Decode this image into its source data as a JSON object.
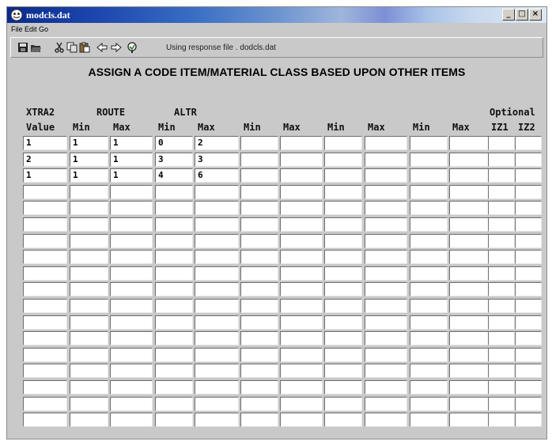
{
  "window": {
    "title": "modcls.dat"
  },
  "menu": [
    "File",
    "Edit",
    "Go"
  ],
  "toolbar": {
    "icons": [
      "save-icon",
      "open-icon",
      "cut-icon",
      "copy-icon",
      "paste-icon",
      "back-arrow-icon",
      "forward-arrow-icon",
      "run-icon"
    ],
    "status": "Using response file . dodcls.dat"
  },
  "heading": "ASSIGN A CODE ITEM/MATERIAL CLASS BASED UPON OTHER ITEMS",
  "headers": {
    "group_row": {
      "xtra2": "XTRA2",
      "route": "ROUTE",
      "altr": "ALTR",
      "optional": "Optional"
    },
    "sub_row": [
      "Value",
      "Min",
      "Max",
      "Min",
      "Max",
      "Min",
      "Max",
      "Min",
      "Max",
      "Min",
      "Max",
      "IZ1",
      "IZ2"
    ]
  },
  "grid": {
    "rows": [
      [
        "1",
        "1",
        "1",
        "0",
        "2",
        "",
        "",
        "",
        "",
        "",
        "",
        "",
        ""
      ],
      [
        "2",
        "1",
        "1",
        "3",
        "3",
        "",
        "",
        "",
        "",
        "",
        "",
        "",
        ""
      ],
      [
        "1",
        "1",
        "1",
        "4",
        "6",
        "",
        "",
        "",
        "",
        "",
        "",
        "",
        ""
      ],
      [
        "",
        "",
        "",
        "",
        "",
        "",
        "",
        "",
        "",
        "",
        "",
        "",
        ""
      ],
      [
        "",
        "",
        "",
        "",
        "",
        "",
        "",
        "",
        "",
        "",
        "",
        "",
        ""
      ],
      [
        "",
        "",
        "",
        "",
        "",
        "",
        "",
        "",
        "",
        "",
        "",
        "",
        ""
      ],
      [
        "",
        "",
        "",
        "",
        "",
        "",
        "",
        "",
        "",
        "",
        "",
        "",
        ""
      ],
      [
        "",
        "",
        "",
        "",
        "",
        "",
        "",
        "",
        "",
        "",
        "",
        "",
        ""
      ],
      [
        "",
        "",
        "",
        "",
        "",
        "",
        "",
        "",
        "",
        "",
        "",
        "",
        ""
      ],
      [
        "",
        "",
        "",
        "",
        "",
        "",
        "",
        "",
        "",
        "",
        "",
        "",
        ""
      ],
      [
        "",
        "",
        "",
        "",
        "",
        "",
        "",
        "",
        "",
        "",
        "",
        "",
        ""
      ],
      [
        "",
        "",
        "",
        "",
        "",
        "",
        "",
        "",
        "",
        "",
        "",
        "",
        ""
      ],
      [
        "",
        "",
        "",
        "",
        "",
        "",
        "",
        "",
        "",
        "",
        "",
        "",
        ""
      ],
      [
        "",
        "",
        "",
        "",
        "",
        "",
        "",
        "",
        "",
        "",
        "",
        "",
        ""
      ],
      [
        "",
        "",
        "",
        "",
        "",
        "",
        "",
        "",
        "",
        "",
        "",
        "",
        ""
      ],
      [
        "",
        "",
        "",
        "",
        "",
        "",
        "",
        "",
        "",
        "",
        "",
        "",
        ""
      ],
      [
        "",
        "",
        "",
        "",
        "",
        "",
        "",
        "",
        "",
        "",
        "",
        "",
        ""
      ],
      [
        "",
        "",
        "",
        "",
        "",
        "",
        "",
        "",
        "",
        "",
        "",
        "",
        ""
      ]
    ]
  }
}
